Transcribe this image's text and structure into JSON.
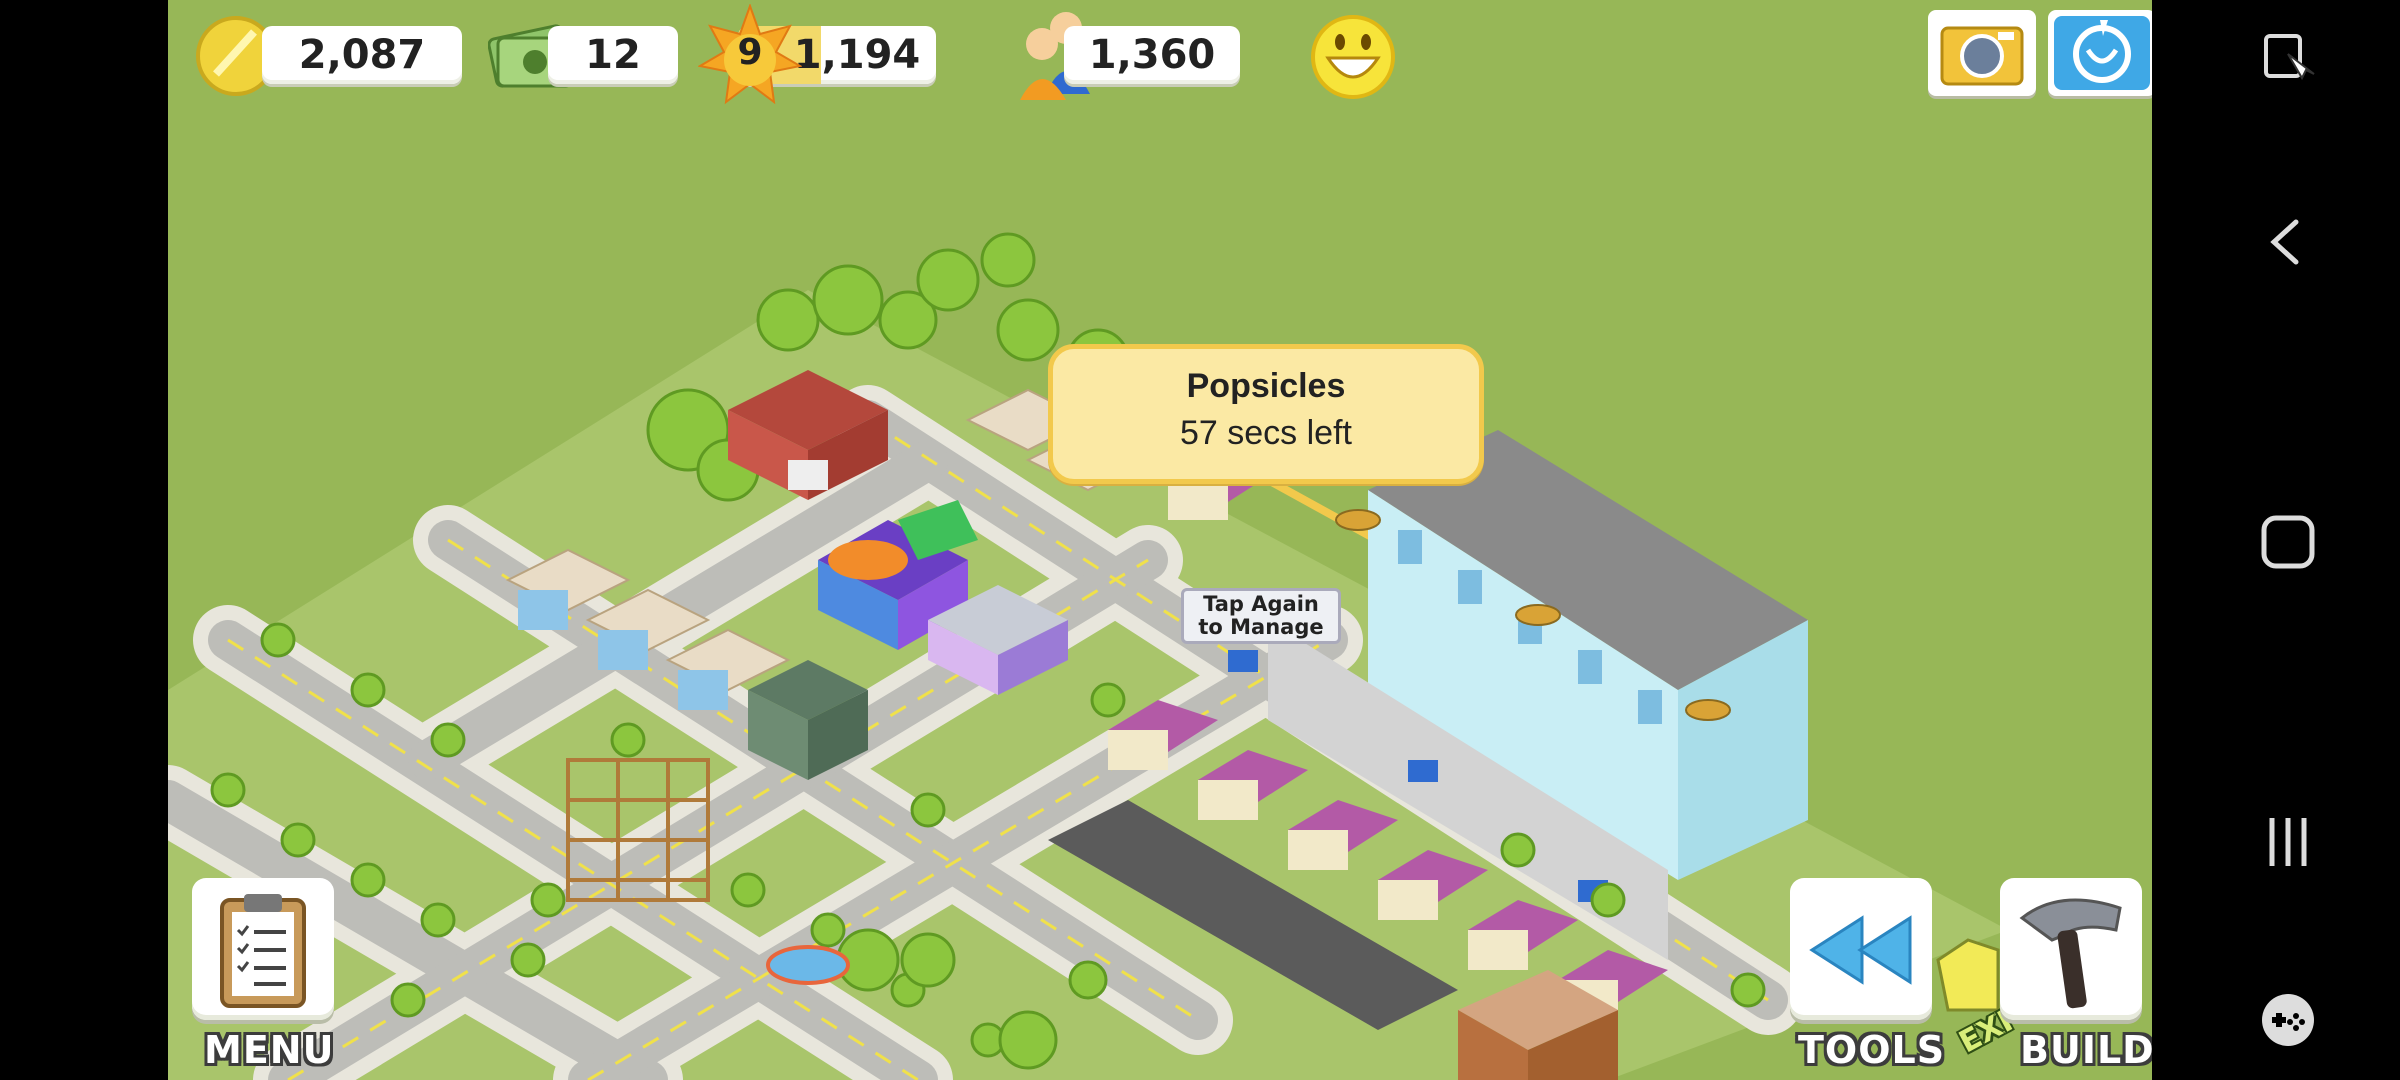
{
  "hud": {
    "coins": "2,087",
    "cash": "12",
    "level": "9",
    "experience": "1,194",
    "population": "1,360",
    "happiness_icon": "smiley-face-icon",
    "experience_fill": 0.42
  },
  "tooltip": {
    "title": "Popsicles",
    "subtitle": "57 secs left"
  },
  "building_label": {
    "line1": "Tap Again",
    "line2": "to Manage"
  },
  "bottom_bar": {
    "menu_label": "MENU",
    "tools_label": "TOOLS",
    "build_label": "BUILD",
    "expand_label": "EXP"
  },
  "icons": {
    "coin": "coin-icon",
    "cash": "cash-icon",
    "level_star": "sun-star-icon",
    "population": "people-icon",
    "camera": "camera-icon",
    "help": "help-icon",
    "menu": "clipboard-icon",
    "tools": "rewind-icon",
    "build": "hammer-icon"
  },
  "colors": {
    "grass": "#97b757",
    "tooltip_bg": "#fbe9a4",
    "tooltip_border": "#f2c94c"
  }
}
